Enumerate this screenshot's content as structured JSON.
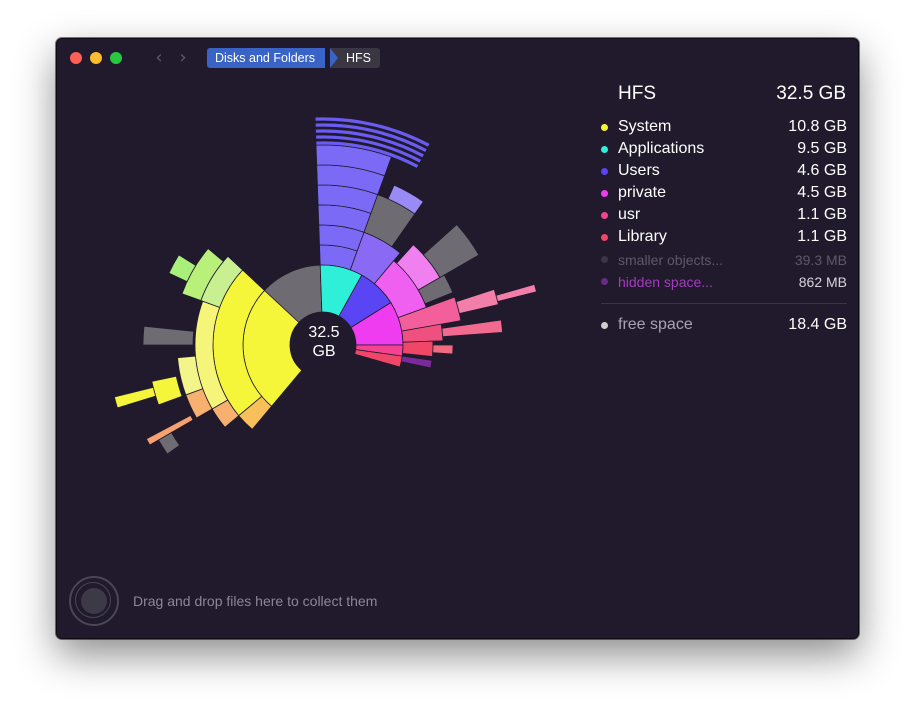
{
  "window": {
    "breadcrumb": [
      "Disks and Folders",
      "HFS"
    ]
  },
  "chart": {
    "center_value": "32.5",
    "center_unit": "GB"
  },
  "panel": {
    "title": "HFS",
    "total": "32.5 GB",
    "items": [
      {
        "label": "System",
        "value": "10.8 GB",
        "color": "#f5f53a"
      },
      {
        "label": "Applications",
        "value": "9.5 GB",
        "color": "#2ef0d8"
      },
      {
        "label": "Users",
        "value": "4.6 GB",
        "color": "#5a45f5"
      },
      {
        "label": "private",
        "value": "4.5 GB",
        "color": "#f03cf0"
      },
      {
        "label": "usr",
        "value": "1.1 GB",
        "color": "#f54292"
      },
      {
        "label": "Library",
        "value": "1.1 GB",
        "color": "#f04668"
      }
    ],
    "smaller": {
      "label": "smaller objects...",
      "value": "39.3",
      "unit": "MB",
      "color": "#3a3644"
    },
    "hidden": {
      "label": "hidden space...",
      "value": "862",
      "unit": "MB",
      "color": "#6a2a8a"
    },
    "free": {
      "label": "free space",
      "value": "18.4 GB",
      "color": "#cfcfcf"
    }
  },
  "dropzone": {
    "text": "Drag and drop files here to collect them"
  }
}
